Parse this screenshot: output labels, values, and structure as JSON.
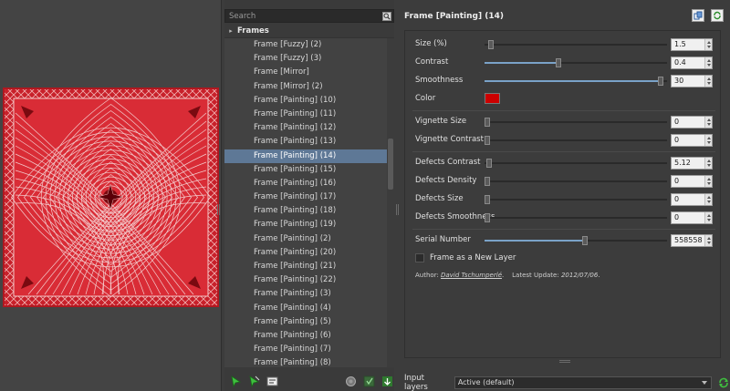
{
  "search": {
    "placeholder": "Search"
  },
  "tree": {
    "category": "Frames",
    "items": [
      "Frame [Fuzzy] (2)",
      "Frame [Fuzzy] (3)",
      "Frame [Mirror]",
      "Frame [Mirror] (2)",
      "Frame [Painting] (10)",
      "Frame [Painting] (11)",
      "Frame [Painting] (12)",
      "Frame [Painting] (13)",
      "Frame [Painting] (14)",
      "Frame [Painting] (15)",
      "Frame [Painting] (16)",
      "Frame [Painting] (17)",
      "Frame [Painting] (18)",
      "Frame [Painting] (19)",
      "Frame [Painting] (2)",
      "Frame [Painting] (20)",
      "Frame [Painting] (21)",
      "Frame [Painting] (22)",
      "Frame [Painting] (3)",
      "Frame [Painting] (4)",
      "Frame [Painting] (5)",
      "Frame [Painting] (6)",
      "Frame [Painting] (7)",
      "Frame [Painting] (8)"
    ],
    "selected_index": 8
  },
  "filter": {
    "title": "Frame [Painting] (14)",
    "params": {
      "size": {
        "label": "Size (%)",
        "value": "1.5",
        "fraction": 0.02
      },
      "contrast": {
        "label": "Contrast",
        "value": "0.4",
        "fraction": 0.4
      },
      "smoothness": {
        "label": "Smoothness",
        "value": "30",
        "fraction": 0.98
      },
      "color": {
        "label": "Color",
        "hex": "#cc0000"
      },
      "vignette_size": {
        "label": "Vignette Size",
        "value": "0",
        "fraction": 0
      },
      "vignette_contrast": {
        "label": "Vignette Contrast",
        "value": "0",
        "fraction": 0
      },
      "defects_contrast": {
        "label": "Defects Contrast",
        "value": "5.12",
        "fraction": 0.01
      },
      "defects_density": {
        "label": "Defects Density",
        "value": "0",
        "fraction": 0
      },
      "defects_size": {
        "label": "Defects Size",
        "value": "0",
        "fraction": 0
      },
      "defects_smoothness": {
        "label": "Defects Smoothness",
        "value": "0",
        "fraction": 0
      },
      "serial_number": {
        "label": "Serial Number",
        "value": "558558",
        "fraction": 0.55
      },
      "new_layer": {
        "label": "Frame as a New Layer",
        "checked": false
      }
    },
    "credits": {
      "author_prefix": "Author:",
      "author": "David Tschumperlé",
      "update_prefix": "Latest Update:",
      "update_date": "2012/07/06"
    }
  },
  "input_layers": {
    "label": "Input layers",
    "value": "Active (default)"
  },
  "colors": {
    "accent": "#5e7896",
    "slider_fill": "#7aa2c8",
    "frame_red": "#cc0000"
  }
}
